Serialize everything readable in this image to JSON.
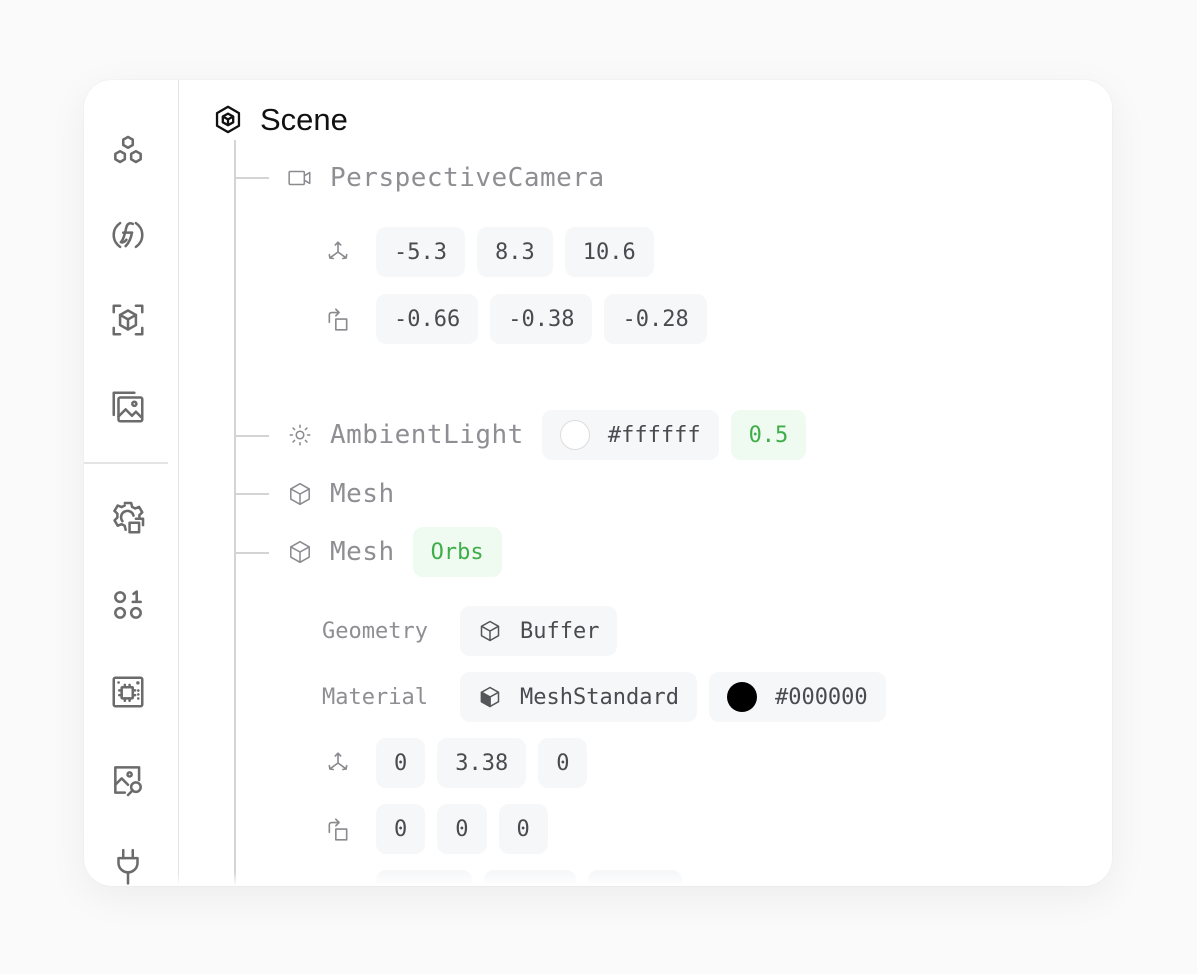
{
  "sidebar": {
    "items_top": [
      {
        "name": "objects",
        "icon": "hexagons-icon"
      },
      {
        "name": "functions",
        "icon": "function-icon"
      },
      {
        "name": "3d-view",
        "icon": "cube-focus-icon"
      },
      {
        "name": "images",
        "icon": "image-stack-icon"
      }
    ],
    "items_bottom": [
      {
        "name": "settings",
        "icon": "gear-square-icon"
      },
      {
        "name": "binary",
        "icon": "binary-icon"
      },
      {
        "name": "hardware",
        "icon": "chip-icon"
      },
      {
        "name": "image-search",
        "icon": "image-search-icon"
      },
      {
        "name": "plugins",
        "icon": "plug-icon"
      }
    ]
  },
  "scene": {
    "title": "Scene",
    "icon": "scene-icon",
    "children": [
      {
        "type": "PerspectiveCamera",
        "icon": "camera-icon",
        "position": [
          "-5.3",
          "8.3",
          "10.6"
        ],
        "rotation": [
          "-0.66",
          "-0.38",
          "-0.28"
        ]
      },
      {
        "type": "AmbientLight",
        "icon": "sun-icon",
        "color": "#ffffff",
        "intensity": "0.5"
      },
      {
        "type": "Mesh",
        "icon": "cube-icon"
      },
      {
        "type": "Mesh",
        "icon": "cube-icon",
        "name": "Orbs",
        "geometry_label": "Geometry",
        "geometry": "Buffer",
        "material_label": "Material",
        "material": "MeshStandard",
        "material_color": "#000000",
        "position": [
          "0",
          "3.38",
          "0"
        ],
        "rotation": [
          "0",
          "0",
          "0"
        ]
      }
    ]
  }
}
